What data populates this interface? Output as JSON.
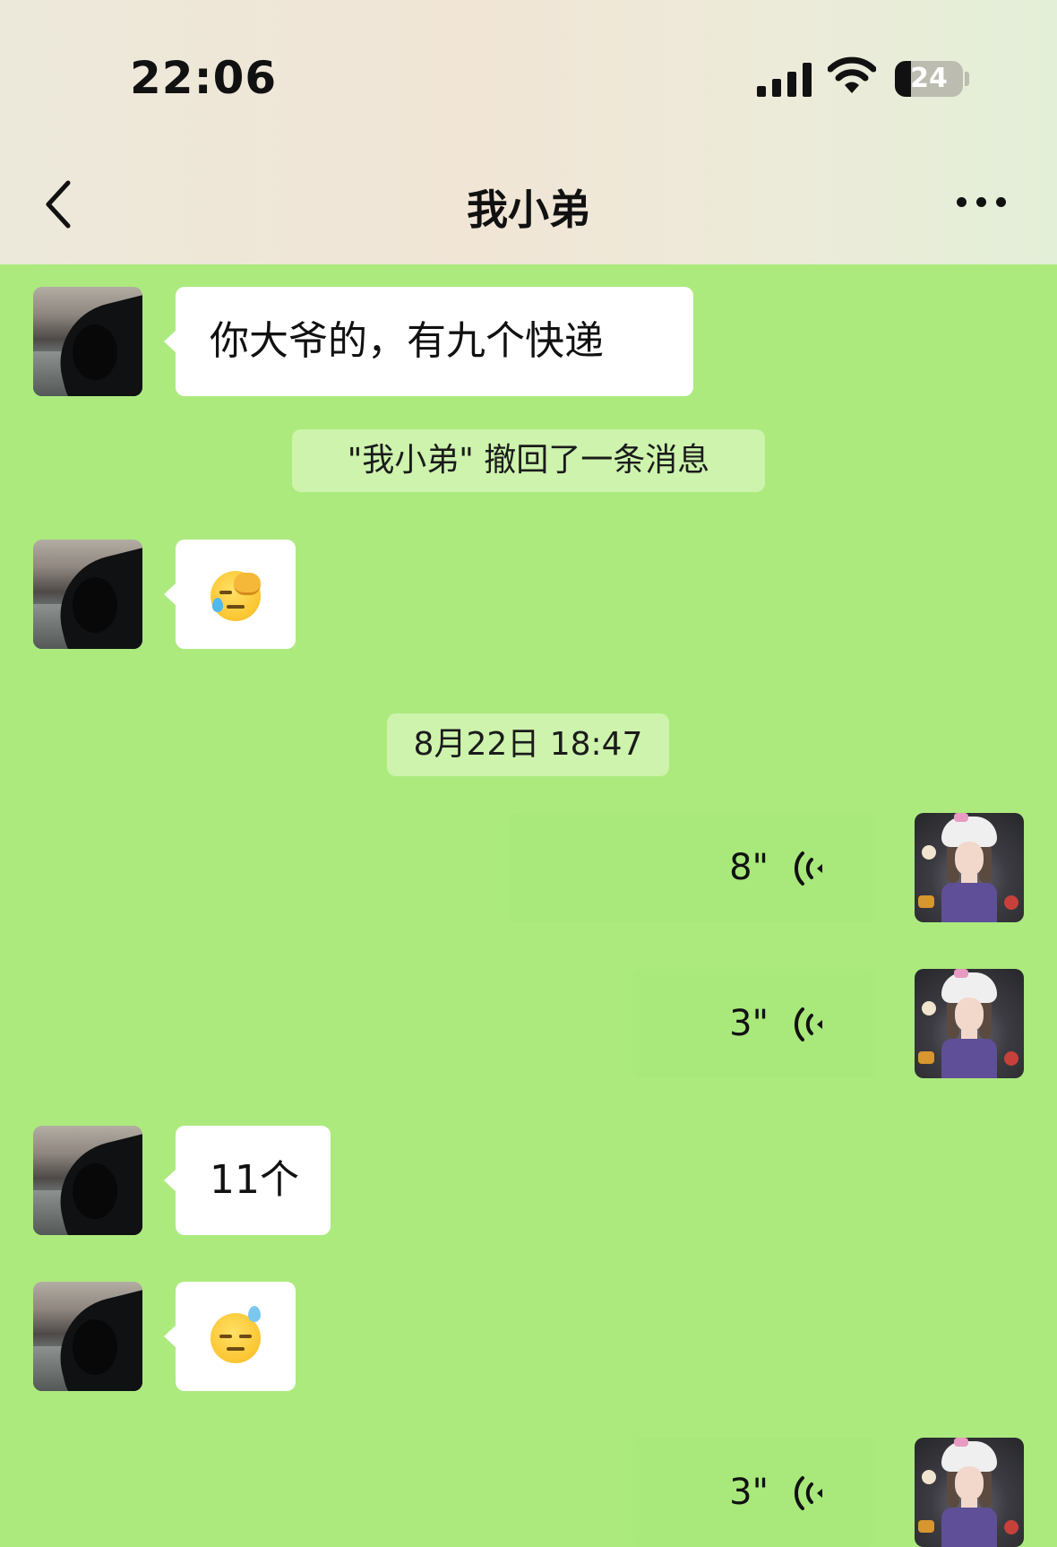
{
  "status_bar": {
    "time": "22:06",
    "battery_level": "24",
    "battery_fraction": 0.24
  },
  "nav": {
    "title": "我小弟",
    "back_icon": "chevron-left-icon",
    "more_icon": "ellipsis-icon"
  },
  "colors": {
    "chat_background": "#acea7e",
    "bubble_incoming": "#ffffff",
    "notice_background": "#cdf3ad"
  },
  "messages": [
    {
      "side": "left",
      "kind": "text",
      "text": "你大爷的，有九个快递"
    },
    {
      "side": "system",
      "kind": "recall",
      "text": "\"我小弟\" 撤回了一条消息"
    },
    {
      "side": "left",
      "kind": "emoji",
      "emoji": "facepalm-crying-emoji"
    },
    {
      "side": "system",
      "kind": "timestamp",
      "text": "8月22日 18:47"
    },
    {
      "side": "right",
      "kind": "voice",
      "duration": "8\""
    },
    {
      "side": "right",
      "kind": "voice",
      "duration": "3\""
    },
    {
      "side": "left",
      "kind": "text",
      "text": "11个"
    },
    {
      "side": "left",
      "kind": "emoji",
      "emoji": "sweat-expressionless-emoji"
    },
    {
      "side": "right",
      "kind": "voice",
      "duration": "3\""
    }
  ]
}
